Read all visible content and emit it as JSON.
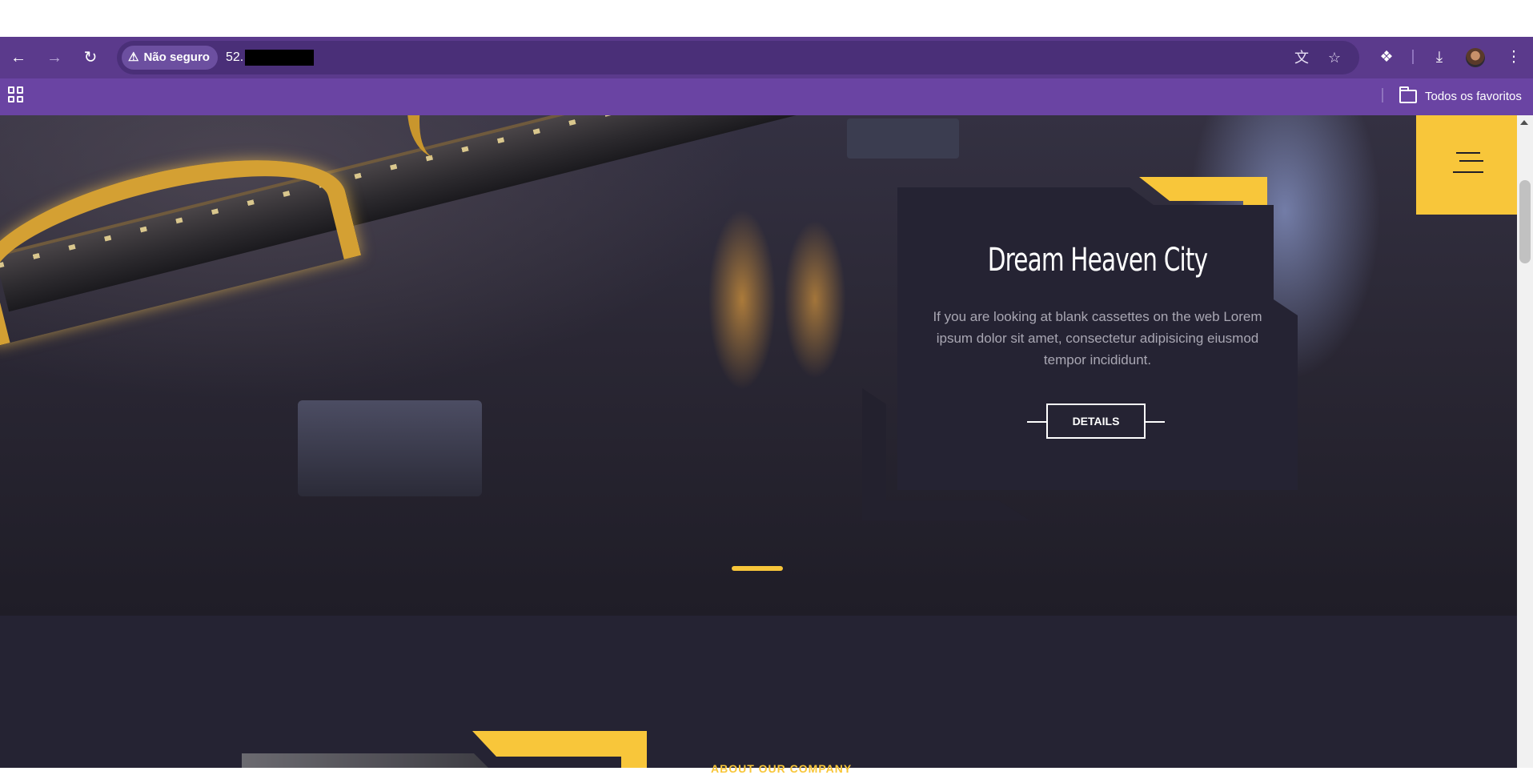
{
  "browser": {
    "security_label": "Não seguro",
    "url_visible": "52.",
    "bookmarks_all_label": "Todos os favoritos",
    "icons": [
      "back-icon",
      "forward-icon",
      "reload-icon",
      "warning-icon",
      "translate-icon",
      "star-icon",
      "extensions-icon",
      "download-icon",
      "avatar",
      "more-vert-icon",
      "apps-icon",
      "folder-icon"
    ],
    "theme_color": "#6a44a3"
  },
  "hero": {
    "title": "Dream Heaven City",
    "description": "If you are looking at blank cassettes on the web Lorem ipsum dolor sit amet, consectetur adipisicing eiusmod tempor incididunt.",
    "button_label": "DETAILS",
    "accent_color": "#f8c63a",
    "card_color": "#252333"
  },
  "about": {
    "label": "ABOUT OUR COMPANY"
  }
}
